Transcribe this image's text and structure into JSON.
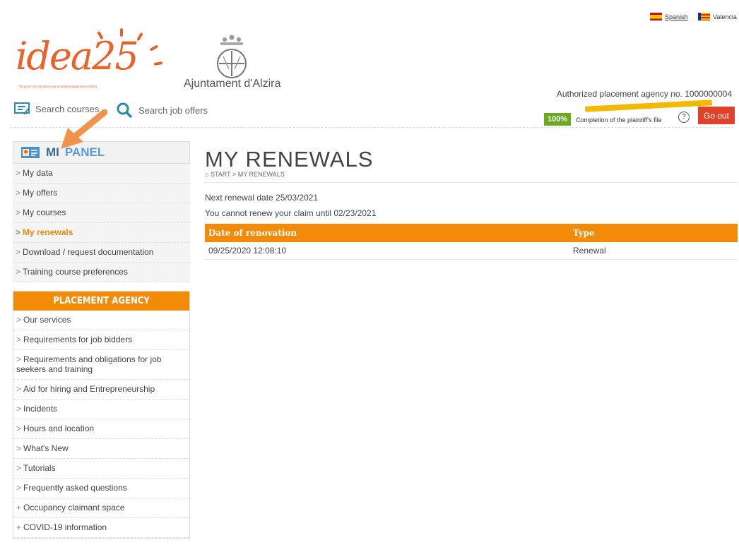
{
  "header": {
    "languages": [
      "Spanish",
      "Valencia"
    ],
    "logo_text": "idea25",
    "logo_tagline": "\"25 anys\" de iniciatives per al desenvolupament d'Alzira",
    "city_name": "Ajuntament d'Alzira",
    "agency_label": "Authorized placement agency no. 1000000004",
    "search_courses": "Search courses",
    "search_jobs": "Search job offers",
    "completion_pct": "100%",
    "completion_label": "Completion of the plaintiff's file",
    "help_symbol": "?",
    "go_out": "Go out"
  },
  "sidebar": {
    "panel_title_1": "MI",
    "panel_title_2": "PANEL",
    "items": [
      {
        "label": "My data",
        "active": false
      },
      {
        "label": "My offers",
        "active": false
      },
      {
        "label": "My courses",
        "active": false
      },
      {
        "label": "My renewals",
        "active": true
      },
      {
        "label": "Download / request documentation",
        "active": false
      },
      {
        "label": "Training course preferences",
        "active": false
      }
    ],
    "agency_title": "PLACEMENT AGENCY",
    "agency_items": [
      {
        "prefix": ">",
        "label": "Our services"
      },
      {
        "prefix": ">",
        "label": "Requirements for job bidders"
      },
      {
        "prefix": ">",
        "label": "Requirements and obligations for job seekers and training"
      },
      {
        "prefix": ">",
        "label": "Aid for hiring and Entrepreneurship"
      },
      {
        "prefix": ">",
        "label": "Incidents"
      },
      {
        "prefix": ">",
        "label": "Hours and location"
      },
      {
        "prefix": ">",
        "label": "What's New"
      },
      {
        "prefix": ">",
        "label": "Tutorials"
      },
      {
        "prefix": ">",
        "label": "Frequently asked questions"
      },
      {
        "prefix": "+",
        "label": "Occupancy claimant space"
      },
      {
        "prefix": "+",
        "label": "COVID-19 information"
      }
    ]
  },
  "main": {
    "title": "MY RENEWALS",
    "breadcrumb": "START > MY RENEWALS",
    "next_renewal": "Next renewal date 25/03/2021",
    "cannot_renew": "You cannot renew your claim until 02/23/2021",
    "table": {
      "headers": [
        "Date of renovation",
        "Type"
      ],
      "rows": [
        [
          "09/25/2020 12:08:10",
          "Renewal"
        ]
      ]
    }
  },
  "colors": {
    "accent": "#f38b09",
    "go_out": "#e2402b",
    "completion": "#6aab1e",
    "mi": "#3b6a8c",
    "panel": "#5b9bd5"
  }
}
